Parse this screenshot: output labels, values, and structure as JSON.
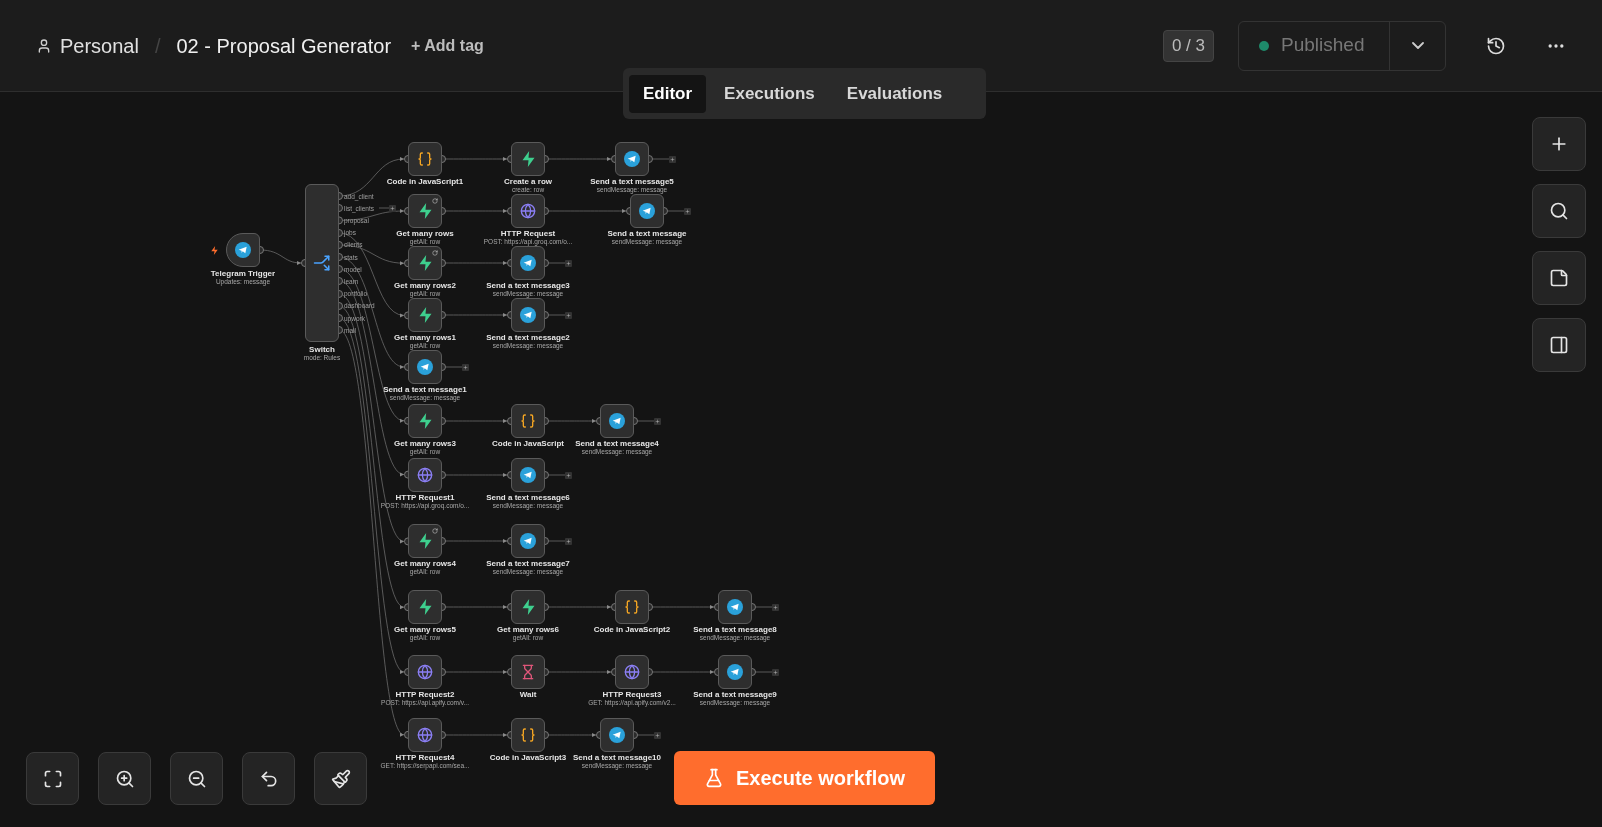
{
  "header": {
    "project": "Personal",
    "separator": "/",
    "workflow_name": "02 - Proposal Generator",
    "add_tag": "+ Add tag",
    "counter": "0 / 3",
    "status": "Published",
    "published": true
  },
  "tabs": [
    {
      "label": "Editor",
      "selected": true
    },
    {
      "label": "Executions",
      "selected": false
    },
    {
      "label": "Evaluations",
      "selected": false
    }
  ],
  "canvas": {
    "trigger": {
      "title": "Telegram Trigger",
      "subtitle": "Updates: message"
    },
    "switch": {
      "title": "Switch",
      "subtitle": "mode: Rules",
      "outputs": [
        {
          "label": "add_client",
          "nodes": [
            {
              "kind": "code",
              "title": "Code in JavaScript1",
              "marked": false
            },
            {
              "kind": "supabase",
              "title": "Create a row",
              "subtitle": "create: row",
              "marked": false
            },
            {
              "kind": "telegram",
              "title": "Send a text message5",
              "subtitle": "sendMessage: message",
              "marked": false
            }
          ]
        },
        {
          "label": "list_clients"
        },
        {
          "label": "proposal",
          "nodes": [
            {
              "kind": "supabase",
              "title": "Get many rows",
              "subtitle": "getAll: row",
              "marked": true
            },
            {
              "kind": "http",
              "title": "HTTP Request",
              "subtitle": "POST: https://api.groq.com/o...",
              "marked": false
            },
            {
              "kind": "telegram",
              "title": "Send a text message",
              "subtitle": "sendMessage: message",
              "marked": false
            }
          ]
        },
        {
          "label": "jobs",
          "nodes": [
            {
              "kind": "supabase",
              "title": "Get many rows1",
              "subtitle": "getAll: row",
              "marked": false
            },
            {
              "kind": "telegram",
              "title": "Send a text message2",
              "subtitle": "sendMessage: message",
              "marked": false
            }
          ]
        },
        {
          "label": "clients",
          "nodes": [
            {
              "kind": "supabase",
              "title": "Get many rows2",
              "subtitle": "getAll: row",
              "marked": true
            },
            {
              "kind": "telegram",
              "title": "Send a text message3",
              "subtitle": "sendMessage: message",
              "marked": false
            }
          ]
        },
        {
          "label": "stats",
          "nodes": [
            {
              "kind": "telegram",
              "title": "Send a text message1",
              "subtitle": "sendMessage: message",
              "marked": false
            }
          ]
        },
        {
          "label": "model",
          "nodes": [
            {
              "kind": "supabase",
              "title": "Get many rows3",
              "subtitle": "getAll: row",
              "marked": false
            },
            {
              "kind": "code",
              "title": "Code in JavaScript",
              "marked": false
            },
            {
              "kind": "telegram",
              "title": "Send a text message4",
              "subtitle": "sendMessage: message",
              "marked": false
            }
          ]
        },
        {
          "label": "learn",
          "nodes": [
            {
              "kind": "http",
              "title": "HTTP Request1",
              "subtitle": "POST: https://api.groq.com/o...",
              "marked": false
            },
            {
              "kind": "telegram",
              "title": "Send a text message6",
              "subtitle": "sendMessage: message",
              "marked": false
            }
          ]
        },
        {
          "label": "portfolio",
          "nodes": [
            {
              "kind": "supabase",
              "title": "Get many rows4",
              "subtitle": "getAll: row",
              "marked": true
            },
            {
              "kind": "telegram",
              "title": "Send a text message7",
              "subtitle": "sendMessage: message",
              "marked": false
            }
          ]
        },
        {
          "label": "dashboard",
          "nodes": [
            {
              "kind": "supabase",
              "title": "Get many rows5",
              "subtitle": "getAll: row",
              "marked": false
            },
            {
              "kind": "supabase",
              "title": "Get many rows6",
              "subtitle": "getAll: row",
              "marked": false
            },
            {
              "kind": "code",
              "title": "Code in JavaScript2",
              "marked": false
            },
            {
              "kind": "telegram",
              "title": "Send a text message8",
              "subtitle": "sendMessage: message",
              "marked": false
            }
          ]
        },
        {
          "label": "upwork",
          "nodes": [
            {
              "kind": "http",
              "title": "HTTP Request2",
              "subtitle": "POST: https://api.apify.com/v...",
              "marked": false
            },
            {
              "kind": "wait",
              "title": "Wait",
              "marked": false
            },
            {
              "kind": "http",
              "title": "HTTP Request3",
              "subtitle": "GET: https://api.apify.com/v2...",
              "marked": false
            },
            {
              "kind": "telegram",
              "title": "Send a text message9",
              "subtitle": "sendMessage: message",
              "marked": false
            }
          ]
        },
        {
          "label": "mail",
          "nodes": [
            {
              "kind": "http",
              "title": "HTTP Request4",
              "subtitle": "GET: https://serpapi.com/sea...",
              "marked": false
            },
            {
              "kind": "code",
              "title": "Code in JavaScript3",
              "marked": false
            },
            {
              "kind": "telegram",
              "title": "Send a text message10",
              "subtitle": "sendMessage: message",
              "marked": false
            }
          ]
        }
      ]
    }
  },
  "execute_button": "Execute workflow"
}
